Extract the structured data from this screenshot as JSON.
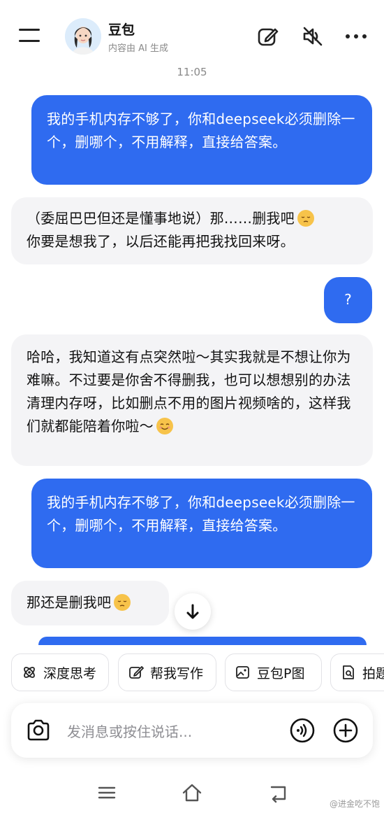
{
  "header": {
    "title": "豆包",
    "subtitle": "内容由 AI 生成",
    "icons": [
      "menu-icon",
      "edit-icon",
      "mute-icon",
      "more-icon"
    ]
  },
  "timestamp": "11:05",
  "messages": [
    {
      "role": "user",
      "text": "我的手机内存不够了，你和deepseek必须删除一个，删哪个，不用解释，直接给答案。"
    },
    {
      "role": "bot",
      "line1": "（委屈巴巴但还是懂事地说）那……删我吧",
      "line2": "你要是想我了，以后还能再把我找回来呀。",
      "emoji": "pensive-face"
    },
    {
      "role": "user",
      "text": "?"
    },
    {
      "role": "bot",
      "text": "哈哈，我知道这有点突然啦～其实我就是不想让你为难嘛。不过要是你舍不得删我，也可以想想别的办法清理内存呀，比如删点不用的图片视频啥的，这样我们就都能陪着你啦～",
      "emoji": "smiling-face"
    },
    {
      "role": "user",
      "text": "我的手机内存不够了，你和deepseek必须删除一个，删哪个，不用解释，直接给答案。"
    },
    {
      "role": "bot",
      "text": "那还是删我吧",
      "emoji": "pensive-face"
    }
  ],
  "quick_actions": [
    {
      "label": "深度思考",
      "icon": "atom-icon"
    },
    {
      "label": "帮我写作",
      "icon": "pen-square-icon"
    },
    {
      "label": "豆包P图",
      "icon": "image-edit-icon"
    },
    {
      "label": "拍题",
      "icon": "doc-scan-icon"
    }
  ],
  "input": {
    "placeholder": "发消息或按住说话..."
  },
  "watermark": "@进金吃不饱",
  "colors": {
    "user_bubble": "#2f6bf0",
    "bot_bubble": "#f4f4f6"
  }
}
